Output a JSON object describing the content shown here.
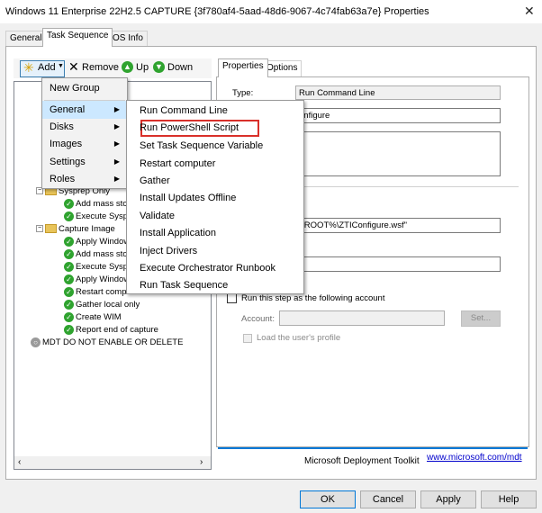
{
  "window": {
    "title": "Windows 11 Enterprise 22H2.5 CAPTURE {3f780af4-5aad-48d6-9067-4c74fab63a7e} Properties",
    "close": "✕"
  },
  "tabs": [
    "General",
    "Task Sequence",
    "OS Info"
  ],
  "toolbar": {
    "add": "Add",
    "remove": "Remove",
    "up": "Up",
    "down": "Down"
  },
  "tree": {
    "visible_items": [
      {
        "label": "Sysprep Only",
        "folder": true
      },
      {
        "label": "Add mass sto"
      },
      {
        "label": "Execute Sysp"
      },
      {
        "label": "Capture Image",
        "folder": true
      },
      {
        "label": "Apply Window"
      },
      {
        "label": "Add mass sto"
      },
      {
        "label": "Execute Sysp"
      },
      {
        "label": "Apply Window"
      },
      {
        "label": "Restart comp"
      },
      {
        "label": "Gather local only"
      },
      {
        "label": "Create WIM"
      },
      {
        "label": "Report end of capture"
      },
      {
        "label": "MDT DO NOT ENABLE OR DELETE"
      }
    ]
  },
  "add_menu": {
    "items": [
      "New Group",
      "General",
      "Disks",
      "Images",
      "Settings",
      "Roles"
    ]
  },
  "general_submenu": {
    "items": [
      "Run Command Line",
      "Run PowerShell Script",
      "Set Task Sequence Variable",
      "Restart computer",
      "Gather",
      "Install Updates Offline",
      "Validate",
      "Install Application",
      "Inject Drivers",
      "Execute Orchestrator Runbook",
      "Run Task Sequence"
    ],
    "highlighted": "Run PowerShell Script"
  },
  "right_tabs": [
    "Properties",
    "Options"
  ],
  "properties": {
    "type_label": "Type:",
    "type_value": "Run Command Line",
    "name_value": "onfigure",
    "command_value": "TROOT%\\ZTIConfigure.wsf\"",
    "run_as_label": "Run this step as the following account",
    "account_label": "Account:",
    "set_button": "Set...",
    "load_profile": "Load the user's profile"
  },
  "footer": {
    "toolkit": "Microsoft Deployment Toolkit",
    "link": "www.microsoft.com/mdt"
  },
  "buttons": {
    "ok": "OK",
    "cancel": "Cancel",
    "apply": "Apply",
    "help": "Help"
  },
  "colors": {
    "highlight_border": "#d9302a",
    "menu_hover": "#cce8ff",
    "accent": "#0078d7"
  }
}
